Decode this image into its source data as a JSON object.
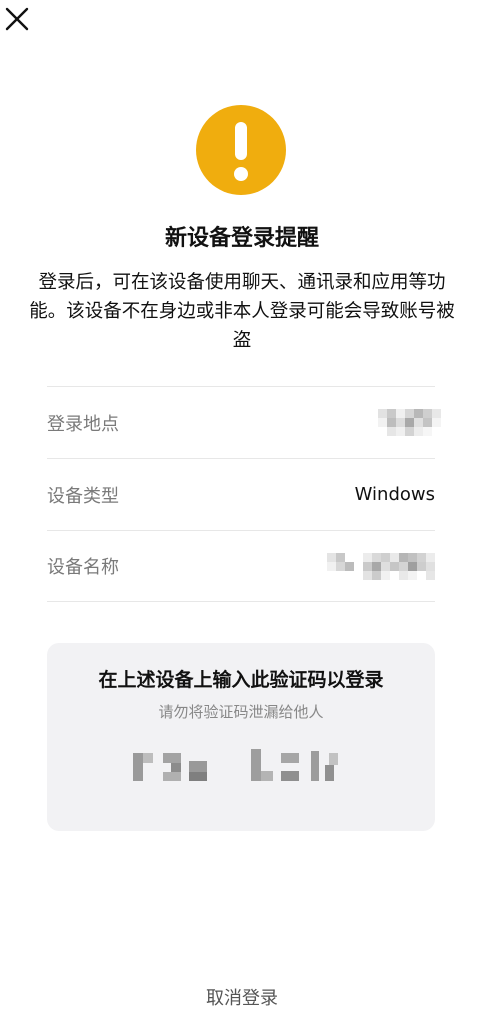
{
  "header": {
    "close_icon": "close-icon"
  },
  "alert": {
    "icon": "exclamation-icon",
    "color": "#f0ad0e"
  },
  "title": "新设备登录提醒",
  "description": "登录后，可在该设备使用聊天、通讯录和应用等功能。该设备不在身边或非本人登录可能会导致账号被盗",
  "info": {
    "rows": [
      {
        "label": "登录地点",
        "value": ""
      },
      {
        "label": "设备类型",
        "value": "Windows"
      },
      {
        "label": "设备名称",
        "value": ""
      }
    ]
  },
  "verify": {
    "title": "在上述设备上输入此验证码以登录",
    "subtitle": "请勿将验证码泄漏给他人"
  },
  "cancel_label": "取消登录"
}
